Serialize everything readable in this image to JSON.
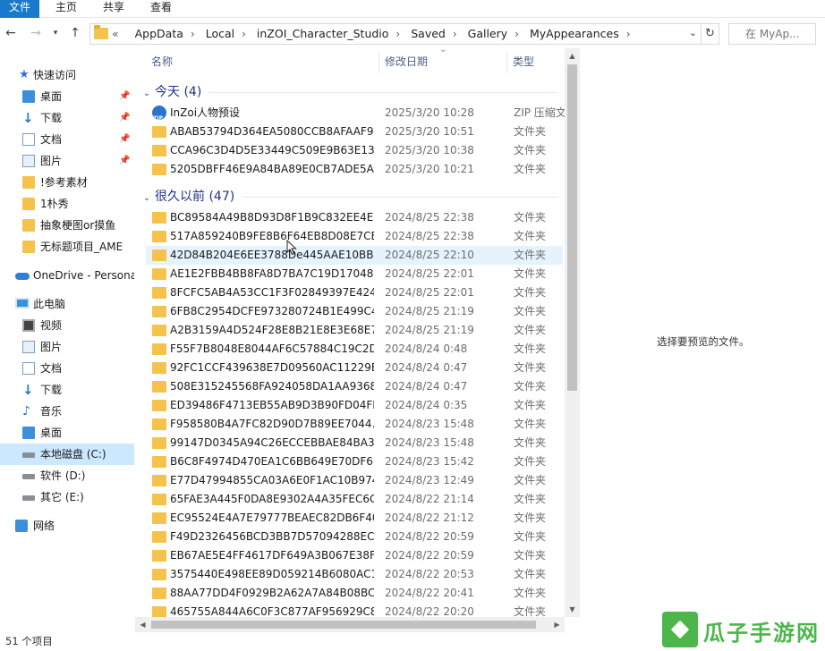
{
  "ribbon": {
    "tabs": [
      "文件",
      "主页",
      "共享",
      "查看"
    ],
    "active_tab": "文件"
  },
  "address": {
    "overflow": "«",
    "crumbs": [
      "AppData",
      "Local",
      "inZOI_Character_Studio",
      "Saved",
      "Gallery",
      "MyAppearances"
    ],
    "search_placeholder": "在 MyAp..."
  },
  "nav": {
    "quick_access": "快速访问",
    "items": [
      {
        "label": "桌面",
        "icon": "desktop-icon",
        "pinned": true
      },
      {
        "label": "下载",
        "icon": "download-icon",
        "pinned": true
      },
      {
        "label": "文档",
        "icon": "document-icon",
        "pinned": true
      },
      {
        "label": "图片",
        "icon": "picture-icon",
        "pinned": true
      },
      {
        "label": "!参考素材",
        "icon": "folder-icon"
      },
      {
        "label": "1朴秀",
        "icon": "folder-icon"
      },
      {
        "label": "抽象梗图or摸鱼",
        "icon": "folder-icon"
      },
      {
        "label": "无标题项目_AME",
        "icon": "folder-icon"
      }
    ],
    "onedrive": "OneDrive - Persona",
    "this_pc": "此电脑",
    "pc_items": [
      {
        "label": "视频",
        "icon": "video-icon"
      },
      {
        "label": "图片",
        "icon": "picture-icon"
      },
      {
        "label": "文档",
        "icon": "document-icon"
      },
      {
        "label": "下载",
        "icon": "download-icon"
      },
      {
        "label": "音乐",
        "icon": "music-icon"
      },
      {
        "label": "桌面",
        "icon": "desktop-icon"
      },
      {
        "label": "本地磁盘 (C:)",
        "icon": "drive-icon",
        "selected": true
      },
      {
        "label": "软件 (D:)",
        "icon": "drive-icon"
      },
      {
        "label": "其它 (E:)",
        "icon": "drive-icon"
      }
    ],
    "network": "网络"
  },
  "columns": {
    "name": "名称",
    "date": "修改日期",
    "type": "类型"
  },
  "groups": [
    {
      "title": "今天 (4)",
      "rows": [
        {
          "name": "InZoi人物预设",
          "date": "2025/3/20 10:28",
          "type": "ZIP 压缩文",
          "icon": "zip"
        },
        {
          "name": "ABAB53794D364EA5080CCB8AFAAF9...",
          "date": "2025/3/20 10:51",
          "type": "文件夹",
          "icon": "folder"
        },
        {
          "name": "CCA96C3D4D5E33449C509E9B63E13...",
          "date": "2025/3/20 10:38",
          "type": "文件夹",
          "icon": "folder"
        },
        {
          "name": "5205DBFF46E9A84BA89E0CB7ADE5A...",
          "date": "2025/3/20 10:21",
          "type": "文件夹",
          "icon": "folder"
        }
      ]
    },
    {
      "title": "很久以前 (47)",
      "rows": [
        {
          "name": "BC89584A49B8D93D8F1B9C832EE4E...",
          "date": "2024/8/25 22:38",
          "type": "文件夹",
          "icon": "folder"
        },
        {
          "name": "517A859240B9FE8B6F64EB8D08E7CB...",
          "date": "2024/8/25 22:38",
          "type": "文件夹",
          "icon": "folder"
        },
        {
          "name": "42D84B204E6EE3788De445AAE10BB...",
          "date": "2024/8/25 22:10",
          "type": "文件夹",
          "icon": "folder",
          "hover": true
        },
        {
          "name": "AE1E2FBB4BB8FA8D7BA7C19D17048...",
          "date": "2024/8/25 22:01",
          "type": "文件夹",
          "icon": "folder"
        },
        {
          "name": "8FCFC5AB4A53CC1F3F02849397E424EF",
          "date": "2024/8/25 22:01",
          "type": "文件夹",
          "icon": "folder"
        },
        {
          "name": "6FB8C2954DCFE973280724B1E499C4...",
          "date": "2024/8/25 21:19",
          "type": "文件夹",
          "icon": "folder"
        },
        {
          "name": "A2B3159A4D524F28E8B21E8E3E68E7...",
          "date": "2024/8/25 21:19",
          "type": "文件夹",
          "icon": "folder"
        },
        {
          "name": "F55F7B8048E8044AF6C57884C19C2D...",
          "date": "2024/8/24 0:48",
          "type": "文件夹",
          "icon": "folder"
        },
        {
          "name": "92FC1CCF439638E7D09560AC11229B...",
          "date": "2024/8/24 0:47",
          "type": "文件夹",
          "icon": "folder"
        },
        {
          "name": "508E315245568FA924058DA1AA9368...",
          "date": "2024/8/24 0:47",
          "type": "文件夹",
          "icon": "folder"
        },
        {
          "name": "ED39486F4713EB55AB9D3B90FD04FE...",
          "date": "2024/8/24 0:35",
          "type": "文件夹",
          "icon": "folder"
        },
        {
          "name": "F958580B4A7FC82D90D7B89EE7044...",
          "date": "2024/8/23 15:48",
          "type": "文件夹",
          "icon": "folder"
        },
        {
          "name": "99147D0345A94C26ECCEBBAE84BA3...",
          "date": "2024/8/23 15:48",
          "type": "文件夹",
          "icon": "folder"
        },
        {
          "name": "B6C8F4974D470EA1C6BB649E70DF6...",
          "date": "2024/8/23 15:42",
          "type": "文件夹",
          "icon": "folder"
        },
        {
          "name": "E77D47994855CA03A6E0F1AC10B974...",
          "date": "2024/8/23 12:49",
          "type": "文件夹",
          "icon": "folder"
        },
        {
          "name": "65FAE3A445F0DA8E9302A4A35FEC6C...",
          "date": "2024/8/22 21:14",
          "type": "文件夹",
          "icon": "folder"
        },
        {
          "name": "EC95524E4A7E79777BEAEC82DB6F40...",
          "date": "2024/8/22 21:12",
          "type": "文件夹",
          "icon": "folder"
        },
        {
          "name": "F49D2326456BCD3BB7D57094288EC...",
          "date": "2024/8/22 20:59",
          "type": "文件夹",
          "icon": "folder"
        },
        {
          "name": "EB67AE5E4FF4617DF649A3B067E38F28",
          "date": "2024/8/22 20:59",
          "type": "文件夹",
          "icon": "folder"
        },
        {
          "name": "3575440E498EE89D059214B6080AC1...",
          "date": "2024/8/22 20:53",
          "type": "文件夹",
          "icon": "folder"
        },
        {
          "name": "88AA77DD4F0929B2A62A7A84B08BC...",
          "date": "2024/8/22 20:41",
          "type": "文件夹",
          "icon": "folder"
        },
        {
          "name": "465755A844A6C0F3C877AF956929C8...",
          "date": "2024/8/22 20:20",
          "type": "文件夹",
          "icon": "folder"
        }
      ]
    }
  ],
  "preview_message": "选择要预览的文件。",
  "status": "51 个项目",
  "watermark": "瓜子手游网",
  "colors": {
    "accent": "#1979ca",
    "folder": "#f5c24c",
    "group_title": "#1e3287",
    "selected": "#cce8ff",
    "hover": "#e5f3ff",
    "watermark": "#4cb64c"
  }
}
